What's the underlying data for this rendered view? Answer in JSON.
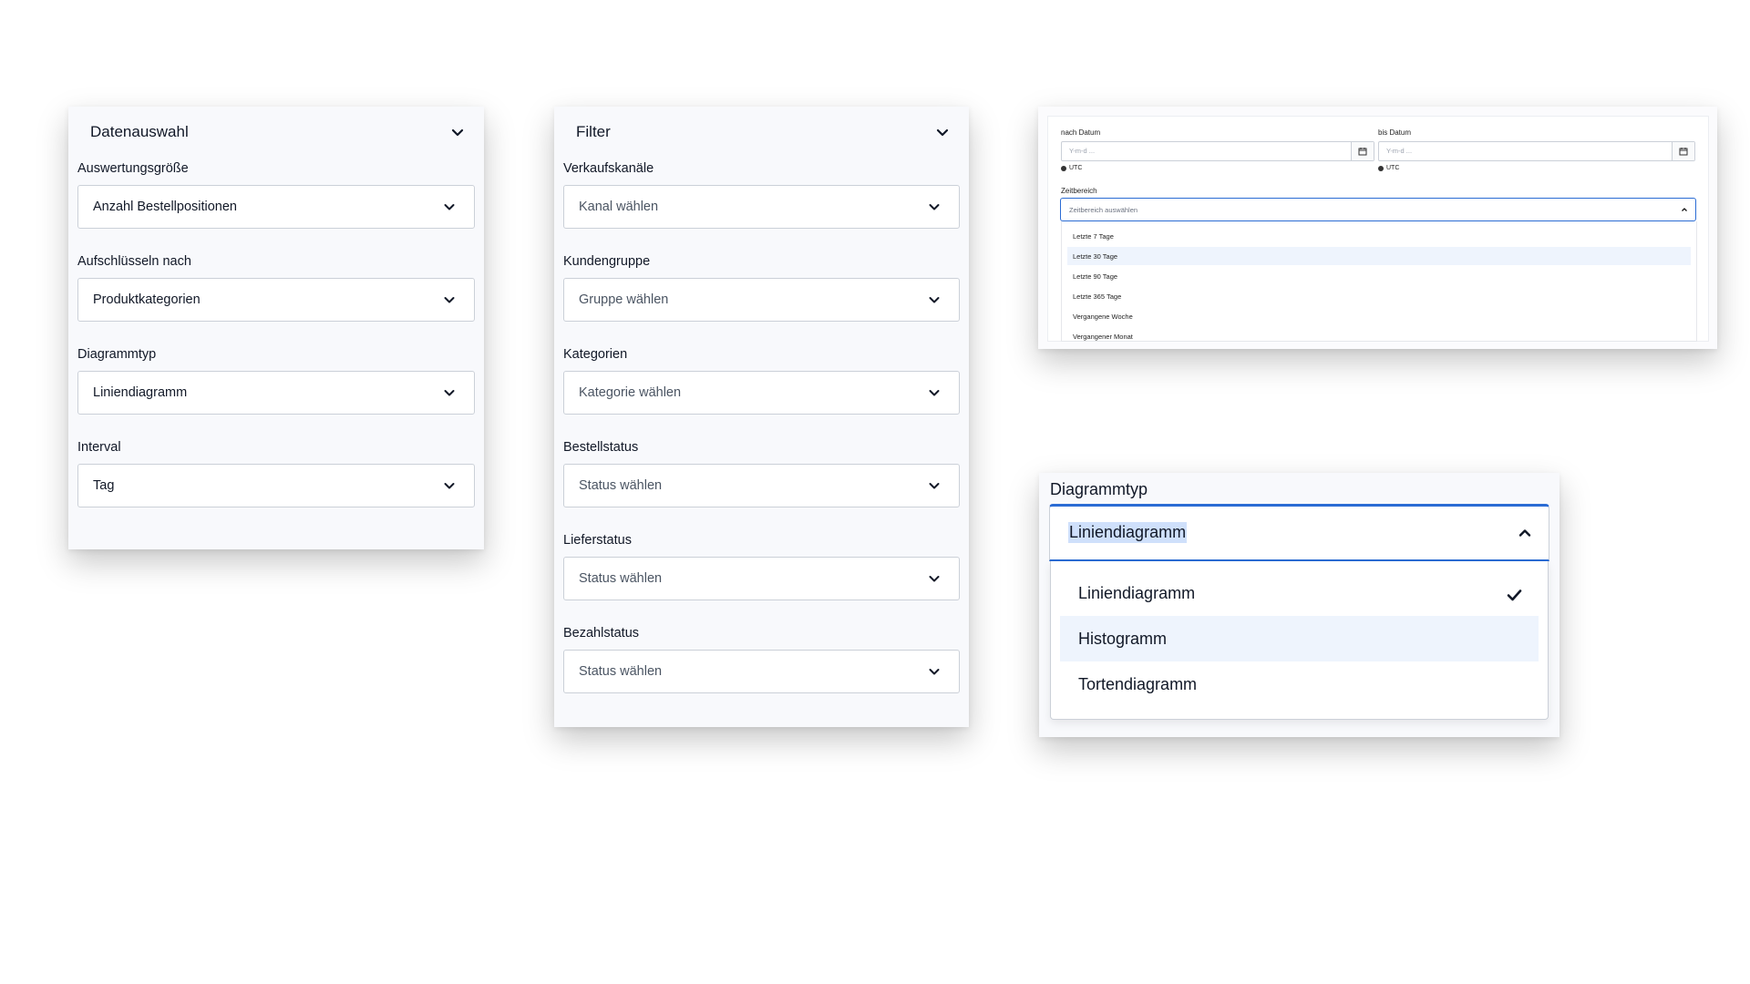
{
  "panel_data": {
    "title": "Datenauswahl",
    "fields": [
      {
        "label": "Auswertungsgröße",
        "value": "Anzahl Bestellpositionen"
      },
      {
        "label": "Aufschlüsseln nach",
        "value": "Produktkategorien"
      },
      {
        "label": "Diagrammtyp",
        "value": "Liniendiagramm"
      },
      {
        "label": "Interval",
        "value": "Tag"
      }
    ]
  },
  "panel_filter": {
    "title": "Filter",
    "fields": [
      {
        "label": "Verkaufskanäle",
        "placeholder": "Kanal wählen"
      },
      {
        "label": "Kundengruppe",
        "placeholder": "Gruppe wählen"
      },
      {
        "label": "Kategorien",
        "placeholder": "Kategorie wählen"
      },
      {
        "label": "Bestellstatus",
        "placeholder": "Status wählen"
      },
      {
        "label": "Lieferstatus",
        "placeholder": "Status wählen"
      },
      {
        "label": "Bezahlstatus",
        "placeholder": "Status wählen"
      }
    ]
  },
  "panel_dates": {
    "from_label": "nach Datum",
    "to_label": "bis Datum",
    "from_placeholder": "Y-m-d ...",
    "to_placeholder": "Y-m-d ...",
    "tz_from": "UTC",
    "tz_to": "UTC",
    "range_label": "Zeitbereich",
    "range_placeholder": "Zeitbereich auswählen",
    "range_options": [
      "Letzte 7 Tage",
      "Letzte 30 Tage",
      "Letzte 90 Tage",
      "Letzte 365 Tage",
      "Vergangene Woche",
      "Vergangener Monat"
    ],
    "highlighted_option": "Letzte 30 Tage"
  },
  "panel_chart_type": {
    "label": "Diagrammtyp",
    "selected": "Liniendiagramm",
    "options": [
      "Liniendiagramm",
      "Histogramm",
      "Tortendiagramm"
    ],
    "hovered_option": "Histogramm"
  },
  "colors": {
    "accent": "#2b6cd4",
    "selection_bg": "#cfe0fb",
    "hover_bg": "#eef4fd",
    "panel_bg": "#f8f9fc"
  },
  "icons": [
    "chevron-down-icon",
    "chevron-up-icon",
    "calendar-icon",
    "checkmark-icon"
  ]
}
